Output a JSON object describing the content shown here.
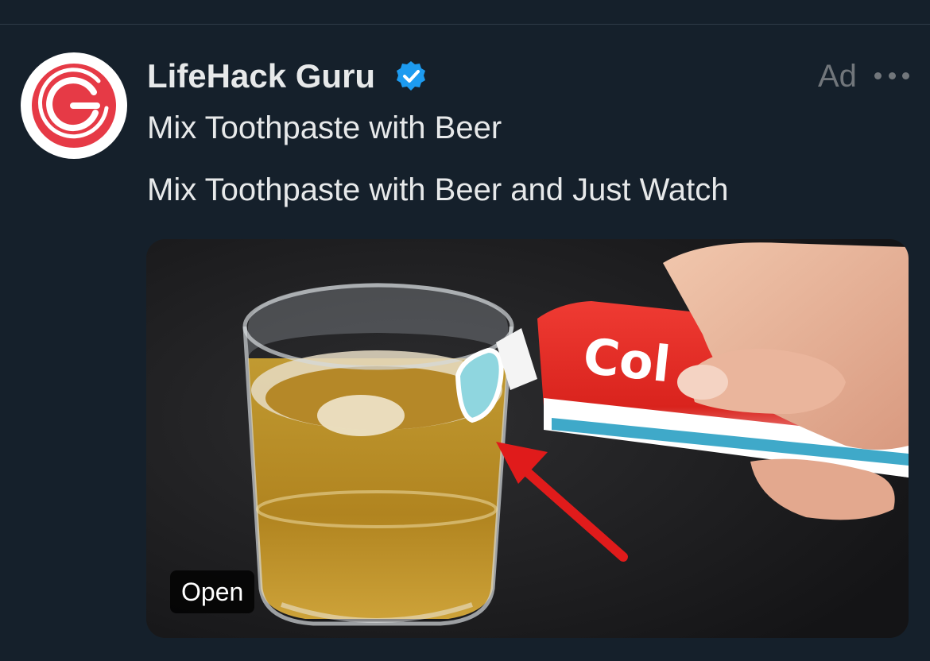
{
  "ad": {
    "advertiser_name": "LifeHack Guru",
    "ad_label": "Ad",
    "headline": "Mix Toothpaste with Beer",
    "body": "Mix Toothpaste with Beer and Just Watch",
    "open_label": "Open",
    "tube_text": "Col"
  },
  "icons": {
    "avatar": "g-logo-icon",
    "verified": "verified-badge-icon",
    "more": "more-options-icon"
  },
  "colors": {
    "background": "#15202b",
    "text_primary": "#e7e9ea",
    "text_secondary": "#71767b",
    "verified_blue": "#1d9bf0",
    "logo_red": "#e63a46"
  }
}
